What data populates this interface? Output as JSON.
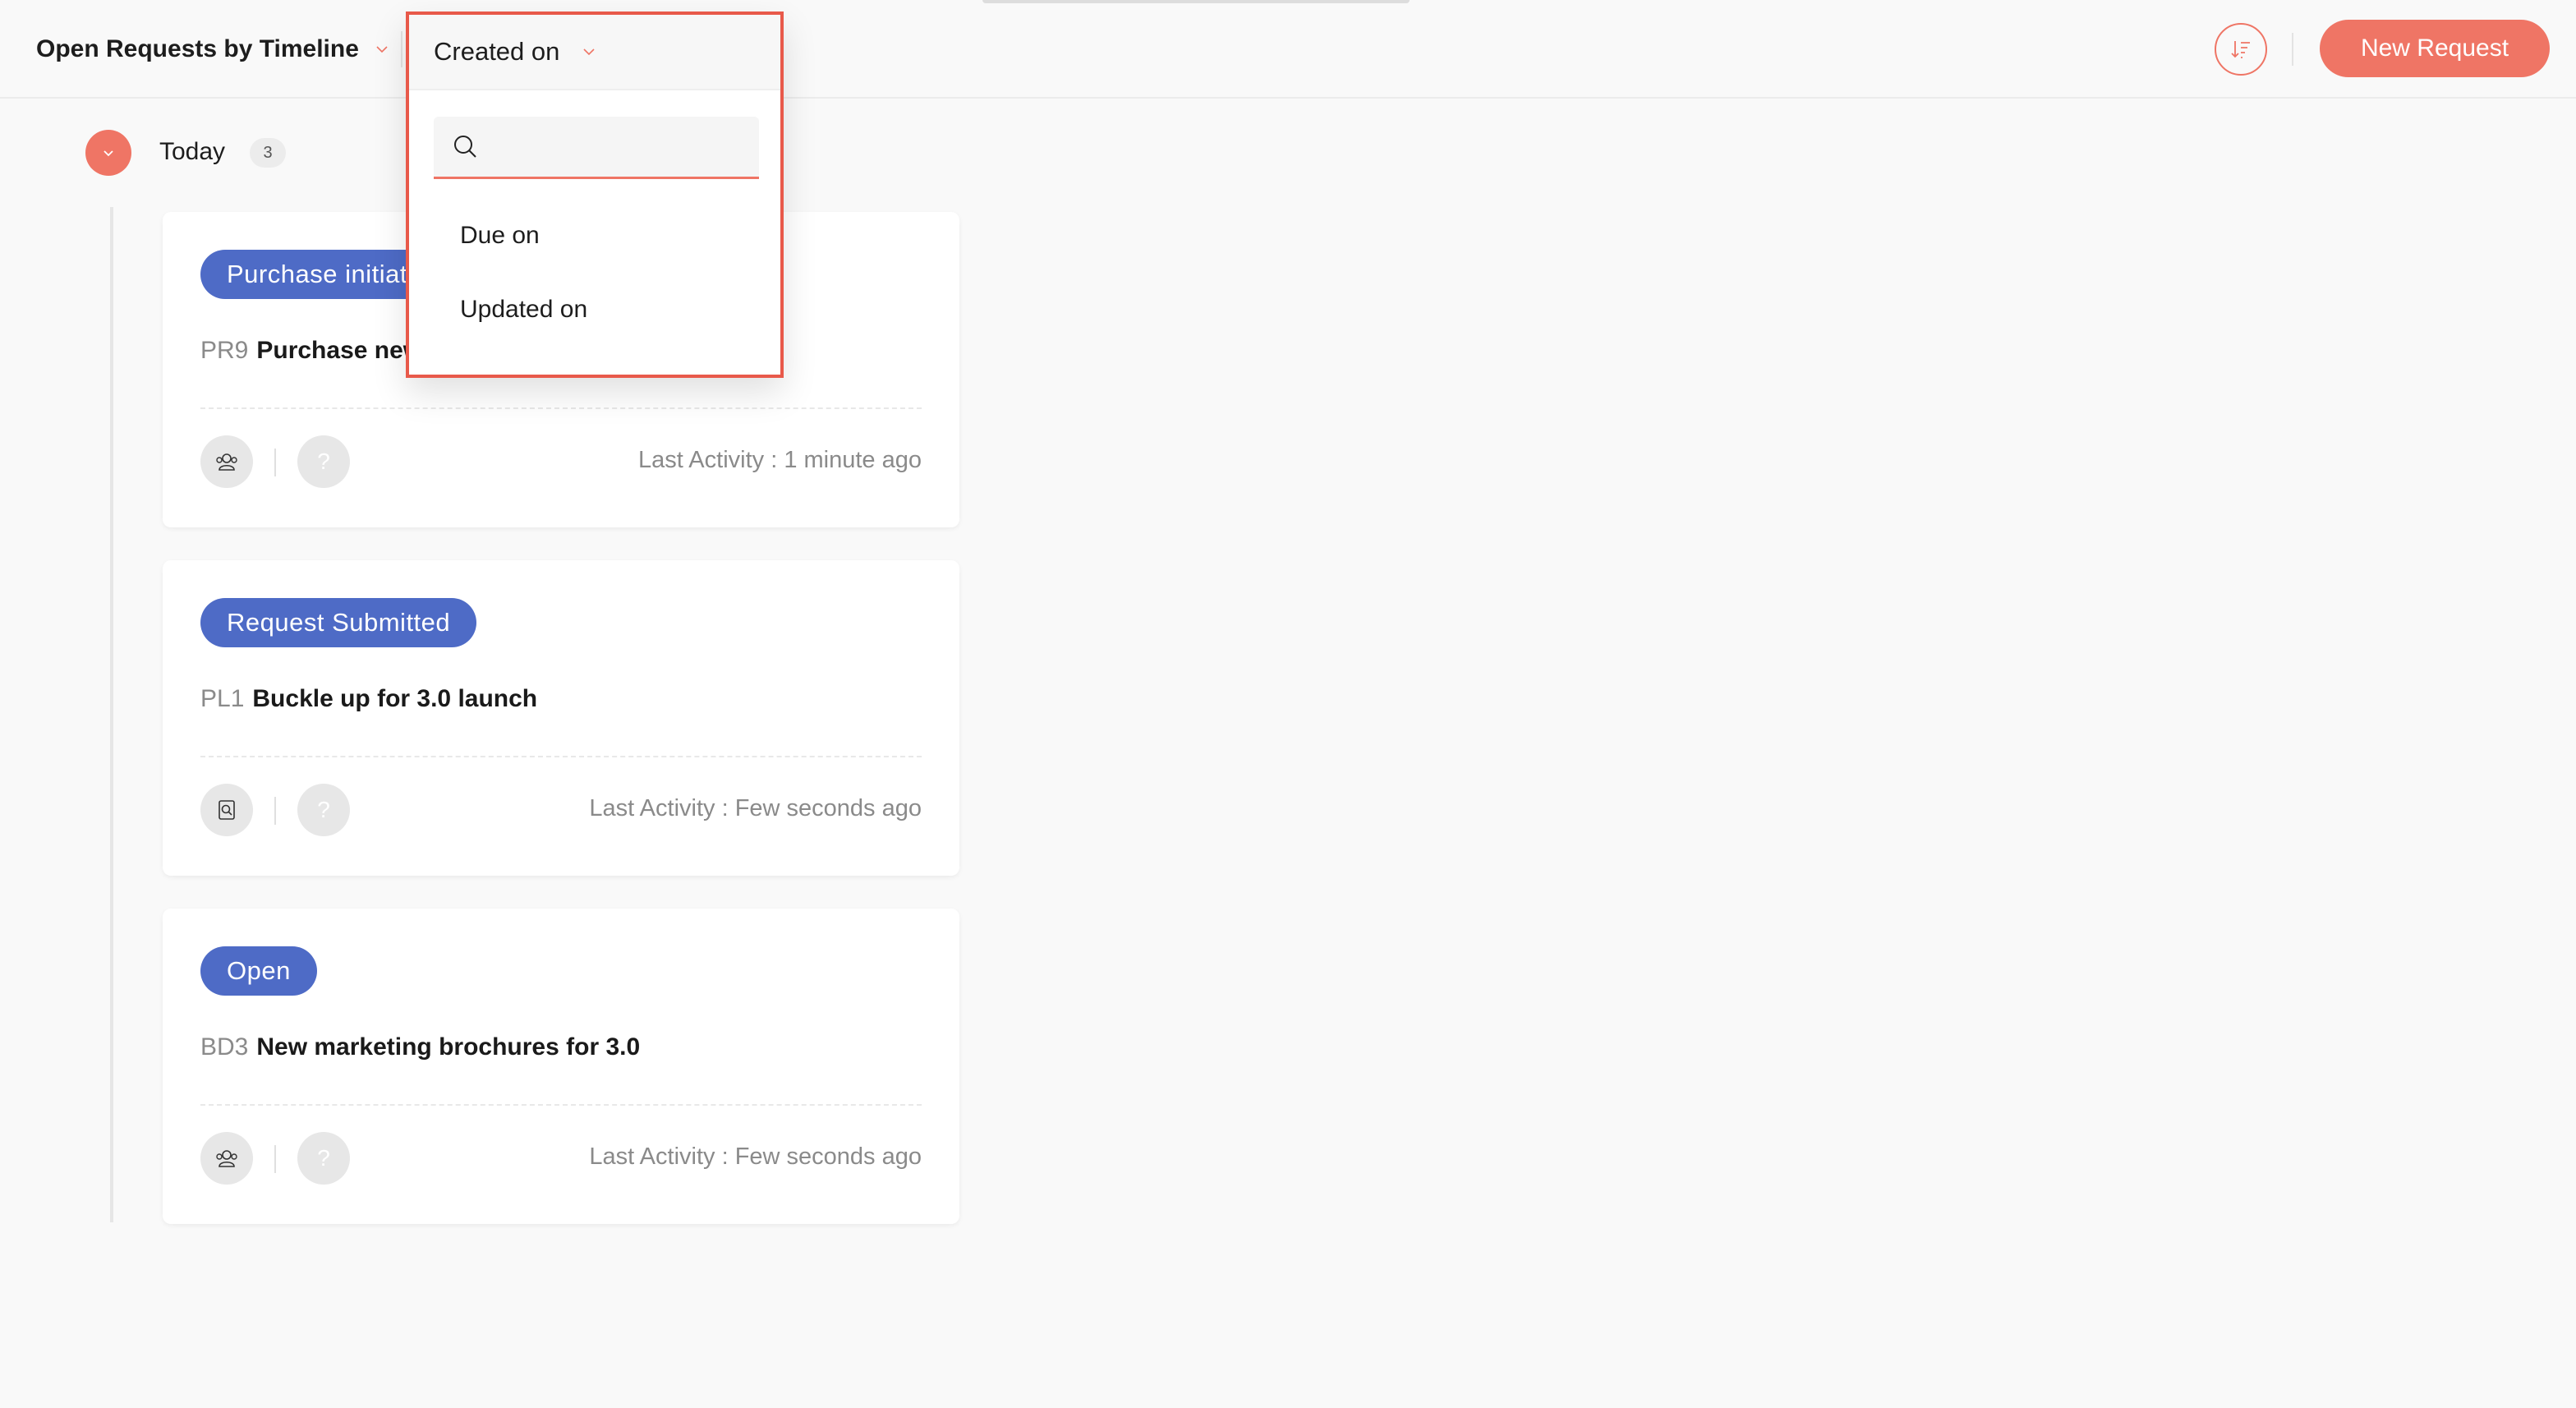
{
  "header": {
    "view_title": "Open Requests by Timeline",
    "new_request_label": "New Request"
  },
  "dropdown": {
    "selected": "Created on",
    "search_placeholder": "",
    "options": [
      "Due on",
      "Updated on"
    ]
  },
  "group": {
    "label": "Today",
    "count": "3"
  },
  "cards": [
    {
      "status": "Purchase initiated",
      "id": "PR9",
      "title": "Purchase new",
      "help": "?",
      "last_activity": "Last Activity : 1 minute ago"
    },
    {
      "status": "Request Submitted",
      "id": "PL1",
      "title": "Buckle up for 3.0 launch",
      "help": "?",
      "last_activity": "Last Activity : Few seconds ago"
    },
    {
      "status": "Open",
      "id": "BD3",
      "title": "New marketing brochures for 3.0",
      "help": "?",
      "last_activity": "Last Activity : Few seconds ago"
    }
  ],
  "colors": {
    "accent": "#ef7565",
    "status_pill": "#4e6bc6",
    "highlight_border": "#e8594a"
  }
}
